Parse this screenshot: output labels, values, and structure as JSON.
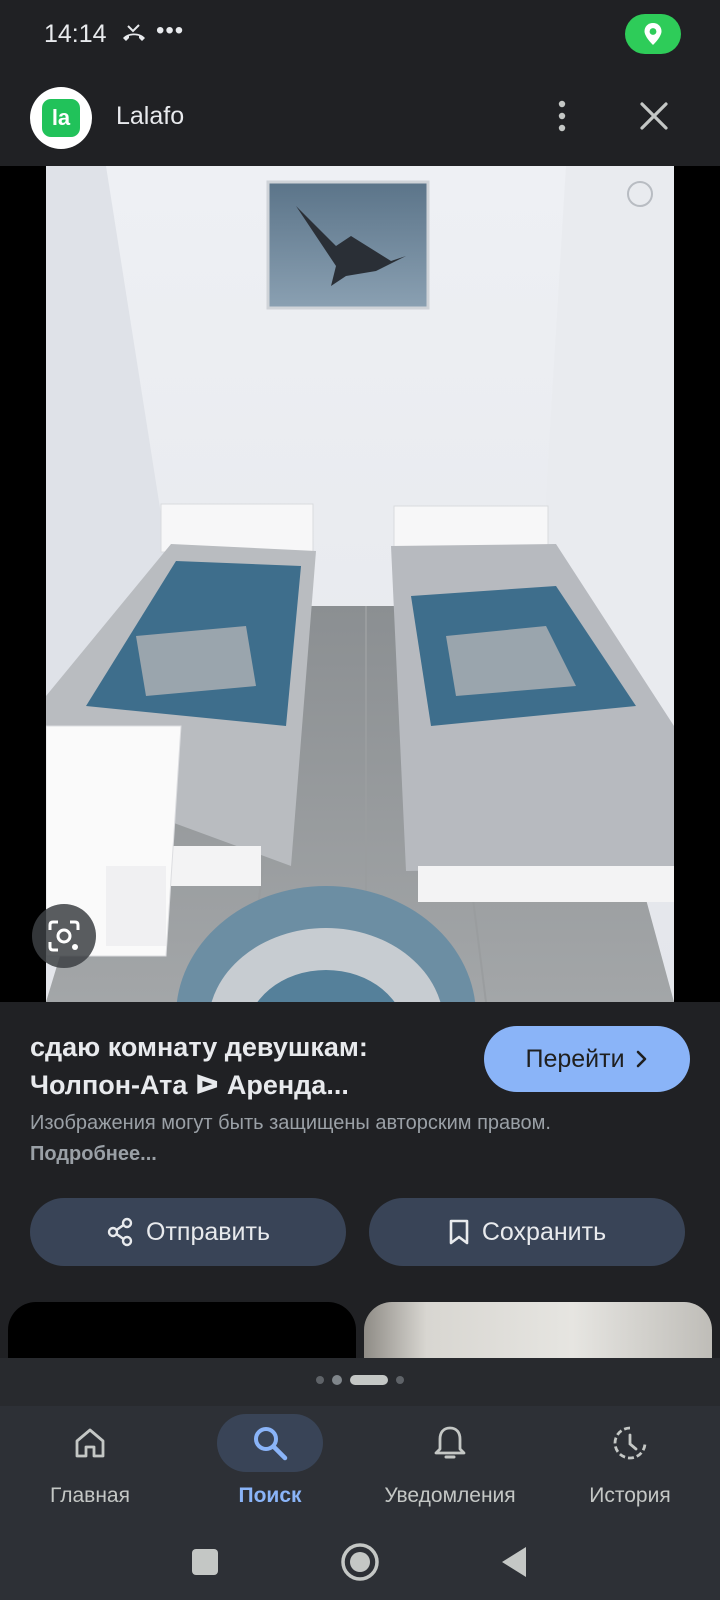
{
  "status_bar": {
    "time": "14:14",
    "more": "•••"
  },
  "header": {
    "site_name": "Lalafo",
    "logo_text": "la"
  },
  "result": {
    "title_line1": "сдаю комнату девушкам:",
    "title_line2": "Чолпон-Ата ᐅ Аренда...",
    "visit_label": "Перейти",
    "copyright_text": "Изображения могут быть защищены авторским правом. ",
    "copyright_more": "Подробнее..."
  },
  "actions": {
    "share_label": "Отправить",
    "save_label": "Сохранить"
  },
  "carousel": {
    "page_count": 4,
    "active_index": 2
  },
  "bottom_nav": {
    "items": [
      {
        "label": "Главная",
        "icon": "home-icon",
        "active": false
      },
      {
        "label": "Поиск",
        "icon": "search-icon",
        "active": true
      },
      {
        "label": "Уведомления",
        "icon": "bell-icon",
        "active": false
      },
      {
        "label": "История",
        "icon": "history-icon",
        "active": false
      }
    ]
  },
  "colors": {
    "background": "#202124",
    "accent": "#8ab4f8",
    "button": "#394457",
    "location": "#2ecc59",
    "brand": "#21c25a"
  }
}
